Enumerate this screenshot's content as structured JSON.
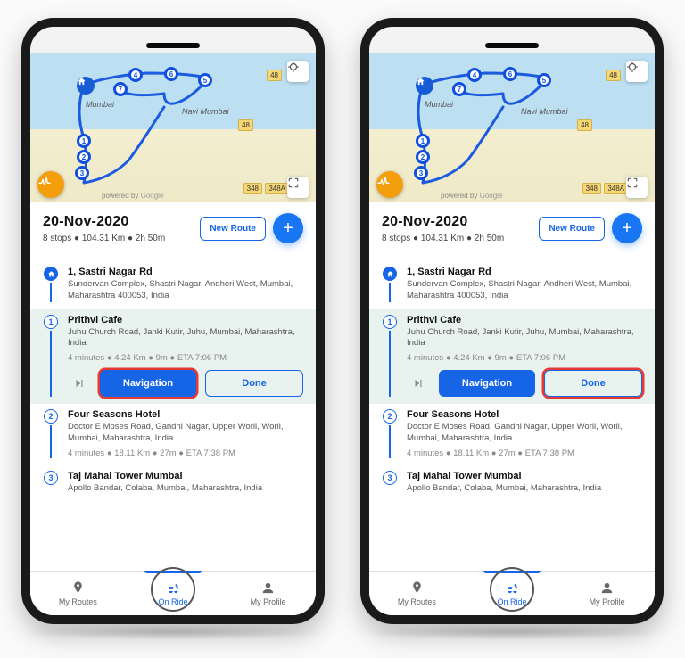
{
  "header": {
    "date": "20-Nov-2020",
    "summary": "8 stops ● 104.31 Km ● 2h 50m",
    "new_route_label": "New Route"
  },
  "map": {
    "city_labels": {
      "main": "Mumbai",
      "sub": "Navi Mumbai"
    },
    "roads": {
      "a": "48",
      "b": "48",
      "c": "348A",
      "d": "348"
    },
    "attribution_prefix": "powered by",
    "attribution_brand": "Google",
    "marker_numbers": [
      "1",
      "2",
      "3",
      "4",
      "5",
      "6",
      "7"
    ]
  },
  "stops": [
    {
      "title": "1, Sastri Nagar Rd",
      "addr": "Sundervan Complex, Shastri Nagar, Andheri West, Mumbai, Maharashtra 400053, India"
    },
    {
      "title": "Prithvi Cafe",
      "addr": "Juhu Church Road, Janki Kutir, Juhu, Mumbai, Maharashtra, India",
      "meta": "4 minutes ● 4.24 Km ● 9m ● ETA 7:06 PM"
    },
    {
      "title": "Four Seasons Hotel",
      "addr": "Doctor E Moses Road, Gandhi Nagar, Upper Worli, Worli, Mumbai, Maharashtra, India",
      "meta": "4 minutes ● 18.11 Km ● 27m ● ETA 7:38 PM"
    },
    {
      "title": "Taj Mahal Tower Mumbai",
      "addr": "Apollo Bandar, Colaba, Mumbai, Maharashtra, India"
    }
  ],
  "actions": {
    "navigation": "Navigation",
    "done": "Done"
  },
  "bottom_nav": {
    "routes": "My Routes",
    "on_ride": "On Ride",
    "profile": "My Profile"
  },
  "stop_indices": {
    "s1": "1",
    "s2": "2",
    "s3": "3"
  }
}
